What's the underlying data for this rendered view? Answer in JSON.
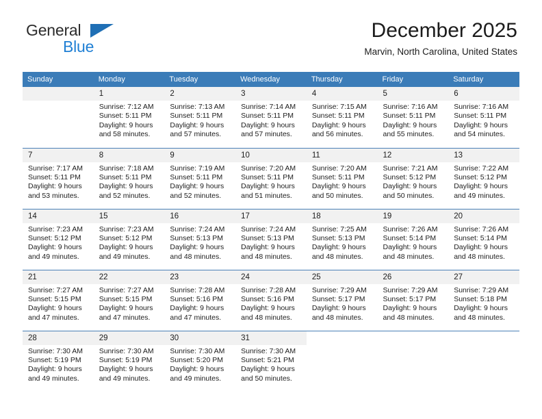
{
  "brand": {
    "name_top": "General",
    "name_bottom": "Blue",
    "triangle_color": "#1f6fb5",
    "text_color": "#2b2b2b",
    "blue_color": "#1f7fd4"
  },
  "header": {
    "title": "December 2025",
    "subtitle": "Marvin, North Carolina, United States"
  },
  "theme": {
    "header_bg": "#3b7cb8",
    "header_text": "#ffffff",
    "daynum_bg": "#f1f1f1",
    "cell_border": "#4a80b6"
  },
  "weekdays": [
    "Sunday",
    "Monday",
    "Tuesday",
    "Wednesday",
    "Thursday",
    "Friday",
    "Saturday"
  ],
  "weeks": [
    [
      {
        "day": "",
        "sunrise": "",
        "sunset": "",
        "daylight1": "",
        "daylight2": "",
        "empty": true
      },
      {
        "day": "1",
        "sunrise": "Sunrise: 7:12 AM",
        "sunset": "Sunset: 5:11 PM",
        "daylight1": "Daylight: 9 hours",
        "daylight2": "and 58 minutes."
      },
      {
        "day": "2",
        "sunrise": "Sunrise: 7:13 AM",
        "sunset": "Sunset: 5:11 PM",
        "daylight1": "Daylight: 9 hours",
        "daylight2": "and 57 minutes."
      },
      {
        "day": "3",
        "sunrise": "Sunrise: 7:14 AM",
        "sunset": "Sunset: 5:11 PM",
        "daylight1": "Daylight: 9 hours",
        "daylight2": "and 57 minutes."
      },
      {
        "day": "4",
        "sunrise": "Sunrise: 7:15 AM",
        "sunset": "Sunset: 5:11 PM",
        "daylight1": "Daylight: 9 hours",
        "daylight2": "and 56 minutes."
      },
      {
        "day": "5",
        "sunrise": "Sunrise: 7:16 AM",
        "sunset": "Sunset: 5:11 PM",
        "daylight1": "Daylight: 9 hours",
        "daylight2": "and 55 minutes."
      },
      {
        "day": "6",
        "sunrise": "Sunrise: 7:16 AM",
        "sunset": "Sunset: 5:11 PM",
        "daylight1": "Daylight: 9 hours",
        "daylight2": "and 54 minutes."
      }
    ],
    [
      {
        "day": "7",
        "sunrise": "Sunrise: 7:17 AM",
        "sunset": "Sunset: 5:11 PM",
        "daylight1": "Daylight: 9 hours",
        "daylight2": "and 53 minutes."
      },
      {
        "day": "8",
        "sunrise": "Sunrise: 7:18 AM",
        "sunset": "Sunset: 5:11 PM",
        "daylight1": "Daylight: 9 hours",
        "daylight2": "and 52 minutes."
      },
      {
        "day": "9",
        "sunrise": "Sunrise: 7:19 AM",
        "sunset": "Sunset: 5:11 PM",
        "daylight1": "Daylight: 9 hours",
        "daylight2": "and 52 minutes."
      },
      {
        "day": "10",
        "sunrise": "Sunrise: 7:20 AM",
        "sunset": "Sunset: 5:11 PM",
        "daylight1": "Daylight: 9 hours",
        "daylight2": "and 51 minutes."
      },
      {
        "day": "11",
        "sunrise": "Sunrise: 7:20 AM",
        "sunset": "Sunset: 5:11 PM",
        "daylight1": "Daylight: 9 hours",
        "daylight2": "and 50 minutes."
      },
      {
        "day": "12",
        "sunrise": "Sunrise: 7:21 AM",
        "sunset": "Sunset: 5:12 PM",
        "daylight1": "Daylight: 9 hours",
        "daylight2": "and 50 minutes."
      },
      {
        "day": "13",
        "sunrise": "Sunrise: 7:22 AM",
        "sunset": "Sunset: 5:12 PM",
        "daylight1": "Daylight: 9 hours",
        "daylight2": "and 49 minutes."
      }
    ],
    [
      {
        "day": "14",
        "sunrise": "Sunrise: 7:23 AM",
        "sunset": "Sunset: 5:12 PM",
        "daylight1": "Daylight: 9 hours",
        "daylight2": "and 49 minutes."
      },
      {
        "day": "15",
        "sunrise": "Sunrise: 7:23 AM",
        "sunset": "Sunset: 5:12 PM",
        "daylight1": "Daylight: 9 hours",
        "daylight2": "and 49 minutes."
      },
      {
        "day": "16",
        "sunrise": "Sunrise: 7:24 AM",
        "sunset": "Sunset: 5:13 PM",
        "daylight1": "Daylight: 9 hours",
        "daylight2": "and 48 minutes."
      },
      {
        "day": "17",
        "sunrise": "Sunrise: 7:24 AM",
        "sunset": "Sunset: 5:13 PM",
        "daylight1": "Daylight: 9 hours",
        "daylight2": "and 48 minutes."
      },
      {
        "day": "18",
        "sunrise": "Sunrise: 7:25 AM",
        "sunset": "Sunset: 5:13 PM",
        "daylight1": "Daylight: 9 hours",
        "daylight2": "and 48 minutes."
      },
      {
        "day": "19",
        "sunrise": "Sunrise: 7:26 AM",
        "sunset": "Sunset: 5:14 PM",
        "daylight1": "Daylight: 9 hours",
        "daylight2": "and 48 minutes."
      },
      {
        "day": "20",
        "sunrise": "Sunrise: 7:26 AM",
        "sunset": "Sunset: 5:14 PM",
        "daylight1": "Daylight: 9 hours",
        "daylight2": "and 48 minutes."
      }
    ],
    [
      {
        "day": "21",
        "sunrise": "Sunrise: 7:27 AM",
        "sunset": "Sunset: 5:15 PM",
        "daylight1": "Daylight: 9 hours",
        "daylight2": "and 47 minutes."
      },
      {
        "day": "22",
        "sunrise": "Sunrise: 7:27 AM",
        "sunset": "Sunset: 5:15 PM",
        "daylight1": "Daylight: 9 hours",
        "daylight2": "and 47 minutes."
      },
      {
        "day": "23",
        "sunrise": "Sunrise: 7:28 AM",
        "sunset": "Sunset: 5:16 PM",
        "daylight1": "Daylight: 9 hours",
        "daylight2": "and 47 minutes."
      },
      {
        "day": "24",
        "sunrise": "Sunrise: 7:28 AM",
        "sunset": "Sunset: 5:16 PM",
        "daylight1": "Daylight: 9 hours",
        "daylight2": "and 48 minutes."
      },
      {
        "day": "25",
        "sunrise": "Sunrise: 7:29 AM",
        "sunset": "Sunset: 5:17 PM",
        "daylight1": "Daylight: 9 hours",
        "daylight2": "and 48 minutes."
      },
      {
        "day": "26",
        "sunrise": "Sunrise: 7:29 AM",
        "sunset": "Sunset: 5:17 PM",
        "daylight1": "Daylight: 9 hours",
        "daylight2": "and 48 minutes."
      },
      {
        "day": "27",
        "sunrise": "Sunrise: 7:29 AM",
        "sunset": "Sunset: 5:18 PM",
        "daylight1": "Daylight: 9 hours",
        "daylight2": "and 48 minutes."
      }
    ],
    [
      {
        "day": "28",
        "sunrise": "Sunrise: 7:30 AM",
        "sunset": "Sunset: 5:19 PM",
        "daylight1": "Daylight: 9 hours",
        "daylight2": "and 49 minutes."
      },
      {
        "day": "29",
        "sunrise": "Sunrise: 7:30 AM",
        "sunset": "Sunset: 5:19 PM",
        "daylight1": "Daylight: 9 hours",
        "daylight2": "and 49 minutes."
      },
      {
        "day": "30",
        "sunrise": "Sunrise: 7:30 AM",
        "sunset": "Sunset: 5:20 PM",
        "daylight1": "Daylight: 9 hours",
        "daylight2": "and 49 minutes."
      },
      {
        "day": "31",
        "sunrise": "Sunrise: 7:30 AM",
        "sunset": "Sunset: 5:21 PM",
        "daylight1": "Daylight: 9 hours",
        "daylight2": "and 50 minutes."
      },
      {
        "day": "",
        "sunrise": "",
        "sunset": "",
        "daylight1": "",
        "daylight2": "",
        "blank": true
      },
      {
        "day": "",
        "sunrise": "",
        "sunset": "",
        "daylight1": "",
        "daylight2": "",
        "blank": true
      },
      {
        "day": "",
        "sunrise": "",
        "sunset": "",
        "daylight1": "",
        "daylight2": "",
        "blank": true
      }
    ]
  ]
}
